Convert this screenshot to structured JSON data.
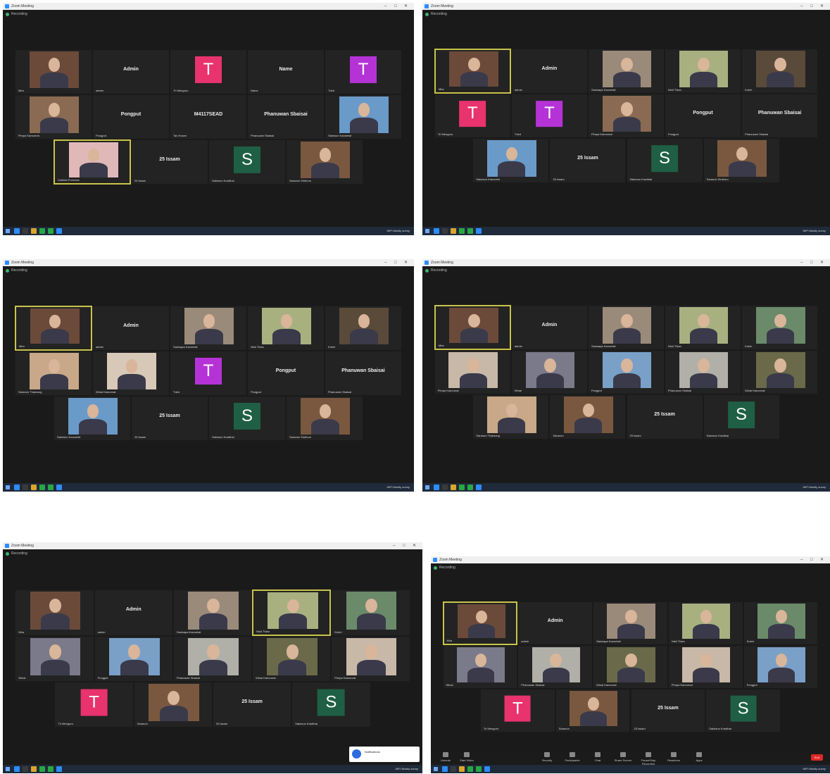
{
  "screens": [
    {
      "title": "Zoom Meeting",
      "recording_label": "Recording",
      "tiles": [
        {
          "kind": "photo",
          "label": "Mira",
          "tone": "#6b4a3a"
        },
        {
          "kind": "name",
          "name": "Admin",
          "label": "admin"
        },
        {
          "kind": "avatar",
          "letter": "T",
          "color": "#e8336f",
          "label": "Tri Mengoro"
        },
        {
          "kind": "name",
          "name": "Name",
          "label": "Name"
        },
        {
          "kind": "avatar",
          "letter": "T",
          "color": "#b533d6",
          "label": "Tded"
        },
        {
          "kind": "photo",
          "label": "Pimpa Kamonrat",
          "tone": "#8a6a52"
        },
        {
          "kind": "name",
          "name": "Pongput",
          "label": "Pongput"
        },
        {
          "kind": "name",
          "name": "M4117SEAD",
          "label": "Tan Hosen"
        },
        {
          "kind": "name",
          "name": "Phanuwan Sbaisai",
          "label": "Phanuwan Sbaisai"
        },
        {
          "kind": "photo",
          "label": "Sakesun Kannetsit",
          "tone": "#6a9ac8"
        },
        {
          "kind": "photo",
          "label": "Suthida Pornchai",
          "tone": "#e0b8b8",
          "active": true
        },
        {
          "kind": "name",
          "name": "25 Issam",
          "label": "25 Issam"
        },
        {
          "kind": "avatar",
          "letter": "S",
          "color": "#1f5f45",
          "label": "Sakesun Kradthai"
        },
        {
          "kind": "photo",
          "label": "Saranon Sinthorn",
          "tone": "#7a5840"
        }
      ]
    },
    {
      "title": "Zoom Meeting",
      "recording_label": "Recording",
      "tiles": [
        {
          "kind": "photo",
          "label": "Mira",
          "tone": "#6b4a3a",
          "active": true
        },
        {
          "kind": "name",
          "name": "Admin",
          "label": "admin"
        },
        {
          "kind": "photo",
          "label": "Sasinapa Kannetsit",
          "tone": "#9a8a7a"
        },
        {
          "kind": "photo",
          "label": "Nisit Thian",
          "tone": "#a8b080"
        },
        {
          "kind": "photo",
          "label": "Kotch",
          "tone": "#5a4a3a"
        },
        {
          "kind": "avatar",
          "letter": "T",
          "color": "#e8336f",
          "label": "Tri Mengoro"
        },
        {
          "kind": "avatar",
          "letter": "T",
          "color": "#b533d6",
          "label": "Tded"
        },
        {
          "kind": "photo",
          "label": "Pimpa Kamonrat",
          "tone": "#8a6a52"
        },
        {
          "kind": "name",
          "name": "Pongput",
          "label": "Pongput"
        },
        {
          "kind": "name",
          "name": "Phanuwan Sbaisai",
          "label": "Phanuwan Sbaisai"
        },
        {
          "kind": "photo",
          "label": "Sakesun Kannetsit",
          "tone": "#6a9ac8"
        },
        {
          "kind": "name",
          "name": "25 Issam",
          "label": "25 Issam"
        },
        {
          "kind": "avatar",
          "letter": "S",
          "color": "#1f5f45",
          "label": "Sakesun Kradthai"
        },
        {
          "kind": "photo",
          "label": "Saranon Sinthorn",
          "tone": "#7a5840"
        }
      ]
    },
    {
      "title": "Zoom Meeting",
      "recording_label": "Recording",
      "tiles": [
        {
          "kind": "photo",
          "label": "Mira",
          "tone": "#6b4a3a",
          "active": true
        },
        {
          "kind": "name",
          "name": "Admin",
          "label": "admin"
        },
        {
          "kind": "photo",
          "label": "Sasinapa Kannetsit",
          "tone": "#9a8a7a"
        },
        {
          "kind": "photo",
          "label": "Nisit Thian",
          "tone": "#a8b080"
        },
        {
          "kind": "photo",
          "label": "Kotch",
          "tone": "#5a4a3a"
        },
        {
          "kind": "photo",
          "label": "Saranon Thaiwong",
          "tone": "#c8a888"
        },
        {
          "kind": "photo",
          "label": "Winai Kamonrat",
          "tone": "#d8c8b8"
        },
        {
          "kind": "avatar",
          "letter": "T",
          "color": "#b533d6",
          "label": "Tded"
        },
        {
          "kind": "name",
          "name": "Pongput",
          "label": "Pongput"
        },
        {
          "kind": "name",
          "name": "Phanuwan Sbaisai",
          "label": "Phanuwan Sbaisai"
        },
        {
          "kind": "photo",
          "label": "Sakesun Kannetsit",
          "tone": "#6a9ac8"
        },
        {
          "kind": "name",
          "name": "25 Issam",
          "label": "25 Issam"
        },
        {
          "kind": "avatar",
          "letter": "S",
          "color": "#1f5f45",
          "label": "Sakesun Kradthai"
        },
        {
          "kind": "photo",
          "label": "Saranon Sinthorn",
          "tone": "#7a5840"
        }
      ]
    },
    {
      "title": "Zoom Meeting",
      "recording_label": "Recording",
      "tiles": [
        {
          "kind": "photo",
          "label": "Mira",
          "tone": "#6b4a3a",
          "active": true
        },
        {
          "kind": "name",
          "name": "Admin",
          "label": "admin"
        },
        {
          "kind": "photo",
          "label": "Sasinapa Kannetsit",
          "tone": "#9a8a7a"
        },
        {
          "kind": "photo",
          "label": "Nisit Thian",
          "tone": "#a8b080"
        },
        {
          "kind": "photo",
          "label": "Kotch",
          "tone": "#6a8a6a"
        },
        {
          "kind": "photo",
          "label": "Pimpa Kamonrat",
          "tone": "#c8b8a8"
        },
        {
          "kind": "photo",
          "label": "Winai",
          "tone": "#7a7a8a"
        },
        {
          "kind": "photo",
          "label": "Pongput",
          "tone": "#7aa0c8"
        },
        {
          "kind": "photo",
          "label": "Phanuwan Sbaisai",
          "tone": "#b0b0a8"
        },
        {
          "kind": "photo",
          "label": "Winai Kamonrat",
          "tone": "#6a6a4a"
        },
        {
          "kind": "photo",
          "label": "Saranon Thaiwong",
          "tone": "#c8a888"
        },
        {
          "kind": "photo",
          "label": "Saranon",
          "tone": "#7a5840"
        },
        {
          "kind": "name",
          "name": "25 Issam",
          "label": "25 Issam"
        },
        {
          "kind": "avatar",
          "letter": "S",
          "color": "#1f5f45",
          "label": "Sakesun Kradthai"
        }
      ]
    },
    {
      "title": "Zoom Meeting",
      "recording_label": "Recording",
      "popup_text": "Notifications",
      "tiles": [
        {
          "kind": "photo",
          "label": "Mira",
          "tone": "#6b4a3a"
        },
        {
          "kind": "name",
          "name": "Admin",
          "label": "admin"
        },
        {
          "kind": "photo",
          "label": "Sasinapa Kannetsit",
          "tone": "#9a8a7a"
        },
        {
          "kind": "photo",
          "label": "Nisit Thian",
          "tone": "#a8b080",
          "active": true
        },
        {
          "kind": "photo",
          "label": "Kotch",
          "tone": "#6a8a6a"
        },
        {
          "kind": "photo",
          "label": "Winai",
          "tone": "#7a7a8a"
        },
        {
          "kind": "photo",
          "label": "Pongput",
          "tone": "#7aa0c8"
        },
        {
          "kind": "photo",
          "label": "Phanuwan Sbaisai",
          "tone": "#b0b0a8"
        },
        {
          "kind": "photo",
          "label": "Winai Kamonrat",
          "tone": "#6a6a4a"
        },
        {
          "kind": "photo",
          "label": "Pimpa Kamonrat",
          "tone": "#c8b8a8"
        },
        {
          "kind": "avatar",
          "letter": "T",
          "color": "#e8336f",
          "label": "Tri Mengoro"
        },
        {
          "kind": "photo",
          "label": "Saranon",
          "tone": "#7a5840"
        },
        {
          "kind": "name",
          "name": "25 Issam",
          "label": "25 Issam"
        },
        {
          "kind": "avatar",
          "letter": "S",
          "color": "#1f5f45",
          "label": "Sakesun Kradthai"
        }
      ]
    },
    {
      "title": "Zoom Meeting",
      "recording_label": "Recording",
      "end_label": "End",
      "controls": [
        "Unmute",
        "Start Video",
        "Security",
        "Participants",
        "Chat",
        "Share Screen",
        "Pause/Stop Recording",
        "Reactions",
        "Apps"
      ],
      "tiles": [
        {
          "kind": "photo",
          "label": "Mira",
          "tone": "#6b4a3a",
          "active": true
        },
        {
          "kind": "name",
          "name": "Admin",
          "label": "admin"
        },
        {
          "kind": "photo",
          "label": "Sasinapa Kannetsit",
          "tone": "#9a8a7a"
        },
        {
          "kind": "photo",
          "label": "Nisit Thian",
          "tone": "#a8b080"
        },
        {
          "kind": "photo",
          "label": "Kotch",
          "tone": "#6a8a6a"
        },
        {
          "kind": "photo",
          "label": "Winai",
          "tone": "#7a7a8a"
        },
        {
          "kind": "photo",
          "label": "Phanuwan Sbaisai",
          "tone": "#b0b0a8"
        },
        {
          "kind": "photo",
          "label": "Winai Kamonrat",
          "tone": "#6a6a4a"
        },
        {
          "kind": "photo",
          "label": "Pimpa Kamonrat",
          "tone": "#c8b8a8"
        },
        {
          "kind": "photo",
          "label": "Pongput",
          "tone": "#7aa0c8"
        },
        {
          "kind": "avatar",
          "letter": "T",
          "color": "#e8336f",
          "label": "Tri Mengoro"
        },
        {
          "kind": "photo",
          "label": "Saranon",
          "tone": "#7a5840"
        },
        {
          "kind": "name",
          "name": "25 Issam",
          "label": "25 Issam"
        },
        {
          "kind": "avatar",
          "letter": "S",
          "color": "#1f5f45",
          "label": "Sakesun Kradthai"
        }
      ]
    }
  ],
  "taskbar": {
    "tray_text": "WiFi  Mostly sunny"
  }
}
